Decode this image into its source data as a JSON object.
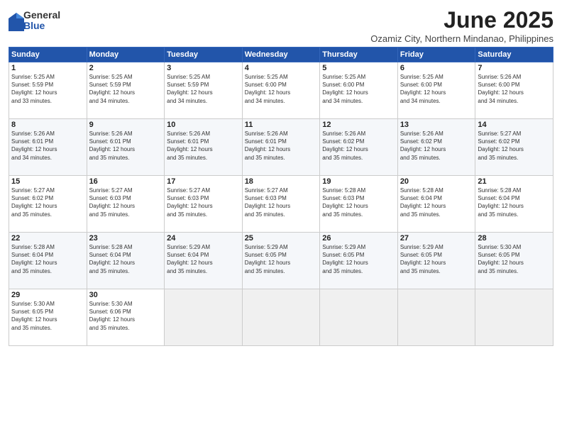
{
  "logo": {
    "general": "General",
    "blue": "Blue"
  },
  "title": {
    "month": "June 2025",
    "location": "Ozamiz City, Northern Mindanao, Philippines"
  },
  "days_header": [
    "Sunday",
    "Monday",
    "Tuesday",
    "Wednesday",
    "Thursday",
    "Friday",
    "Saturday"
  ],
  "weeks": [
    [
      {
        "num": "1",
        "info": "Sunrise: 5:25 AM\nSunset: 5:59 PM\nDaylight: 12 hours\nand 33 minutes."
      },
      {
        "num": "2",
        "info": "Sunrise: 5:25 AM\nSunset: 5:59 PM\nDaylight: 12 hours\nand 34 minutes."
      },
      {
        "num": "3",
        "info": "Sunrise: 5:25 AM\nSunset: 5:59 PM\nDaylight: 12 hours\nand 34 minutes."
      },
      {
        "num": "4",
        "info": "Sunrise: 5:25 AM\nSunset: 6:00 PM\nDaylight: 12 hours\nand 34 minutes."
      },
      {
        "num": "5",
        "info": "Sunrise: 5:25 AM\nSunset: 6:00 PM\nDaylight: 12 hours\nand 34 minutes."
      },
      {
        "num": "6",
        "info": "Sunrise: 5:25 AM\nSunset: 6:00 PM\nDaylight: 12 hours\nand 34 minutes."
      },
      {
        "num": "7",
        "info": "Sunrise: 5:26 AM\nSunset: 6:00 PM\nDaylight: 12 hours\nand 34 minutes."
      }
    ],
    [
      {
        "num": "8",
        "info": "Sunrise: 5:26 AM\nSunset: 6:01 PM\nDaylight: 12 hours\nand 34 minutes."
      },
      {
        "num": "9",
        "info": "Sunrise: 5:26 AM\nSunset: 6:01 PM\nDaylight: 12 hours\nand 35 minutes."
      },
      {
        "num": "10",
        "info": "Sunrise: 5:26 AM\nSunset: 6:01 PM\nDaylight: 12 hours\nand 35 minutes."
      },
      {
        "num": "11",
        "info": "Sunrise: 5:26 AM\nSunset: 6:01 PM\nDaylight: 12 hours\nand 35 minutes."
      },
      {
        "num": "12",
        "info": "Sunrise: 5:26 AM\nSunset: 6:02 PM\nDaylight: 12 hours\nand 35 minutes."
      },
      {
        "num": "13",
        "info": "Sunrise: 5:26 AM\nSunset: 6:02 PM\nDaylight: 12 hours\nand 35 minutes."
      },
      {
        "num": "14",
        "info": "Sunrise: 5:27 AM\nSunset: 6:02 PM\nDaylight: 12 hours\nand 35 minutes."
      }
    ],
    [
      {
        "num": "15",
        "info": "Sunrise: 5:27 AM\nSunset: 6:02 PM\nDaylight: 12 hours\nand 35 minutes."
      },
      {
        "num": "16",
        "info": "Sunrise: 5:27 AM\nSunset: 6:03 PM\nDaylight: 12 hours\nand 35 minutes."
      },
      {
        "num": "17",
        "info": "Sunrise: 5:27 AM\nSunset: 6:03 PM\nDaylight: 12 hours\nand 35 minutes."
      },
      {
        "num": "18",
        "info": "Sunrise: 5:27 AM\nSunset: 6:03 PM\nDaylight: 12 hours\nand 35 minutes."
      },
      {
        "num": "19",
        "info": "Sunrise: 5:28 AM\nSunset: 6:03 PM\nDaylight: 12 hours\nand 35 minutes."
      },
      {
        "num": "20",
        "info": "Sunrise: 5:28 AM\nSunset: 6:04 PM\nDaylight: 12 hours\nand 35 minutes."
      },
      {
        "num": "21",
        "info": "Sunrise: 5:28 AM\nSunset: 6:04 PM\nDaylight: 12 hours\nand 35 minutes."
      }
    ],
    [
      {
        "num": "22",
        "info": "Sunrise: 5:28 AM\nSunset: 6:04 PM\nDaylight: 12 hours\nand 35 minutes."
      },
      {
        "num": "23",
        "info": "Sunrise: 5:28 AM\nSunset: 6:04 PM\nDaylight: 12 hours\nand 35 minutes."
      },
      {
        "num": "24",
        "info": "Sunrise: 5:29 AM\nSunset: 6:04 PM\nDaylight: 12 hours\nand 35 minutes."
      },
      {
        "num": "25",
        "info": "Sunrise: 5:29 AM\nSunset: 6:05 PM\nDaylight: 12 hours\nand 35 minutes."
      },
      {
        "num": "26",
        "info": "Sunrise: 5:29 AM\nSunset: 6:05 PM\nDaylight: 12 hours\nand 35 minutes."
      },
      {
        "num": "27",
        "info": "Sunrise: 5:29 AM\nSunset: 6:05 PM\nDaylight: 12 hours\nand 35 minutes."
      },
      {
        "num": "28",
        "info": "Sunrise: 5:30 AM\nSunset: 6:05 PM\nDaylight: 12 hours\nand 35 minutes."
      }
    ],
    [
      {
        "num": "29",
        "info": "Sunrise: 5:30 AM\nSunset: 6:05 PM\nDaylight: 12 hours\nand 35 minutes."
      },
      {
        "num": "30",
        "info": "Sunrise: 5:30 AM\nSunset: 6:06 PM\nDaylight: 12 hours\nand 35 minutes."
      },
      {
        "num": "",
        "info": ""
      },
      {
        "num": "",
        "info": ""
      },
      {
        "num": "",
        "info": ""
      },
      {
        "num": "",
        "info": ""
      },
      {
        "num": "",
        "info": ""
      }
    ]
  ]
}
